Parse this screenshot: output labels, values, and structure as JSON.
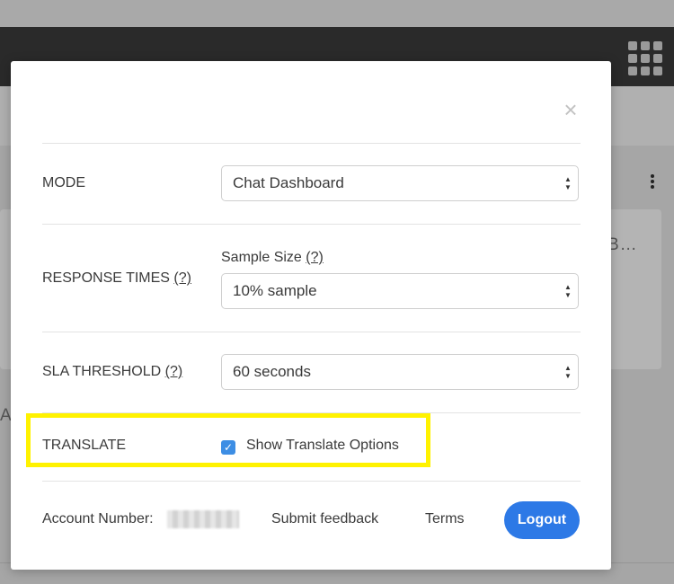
{
  "background": {
    "card_text": "B…",
    "side_letter": "A"
  },
  "modal": {
    "close_icon": "×",
    "mode": {
      "label": "MODE",
      "value": "Chat Dashboard"
    },
    "response_times": {
      "label": "RESPONSE TIMES",
      "help": "(?)",
      "sample_label": "Sample Size",
      "sample_help": "(?)",
      "value": "10% sample"
    },
    "sla": {
      "label": "SLA THRESHOLD",
      "help": "(?)",
      "value": "60 seconds"
    },
    "translate": {
      "label": "TRANSLATE",
      "checkbox_label": "Show Translate Options",
      "checked": true
    },
    "footer": {
      "account_label": "Account Number:",
      "submit_feedback": "Submit feedback",
      "terms": "Terms",
      "logout": "Logout"
    }
  },
  "colors": {
    "accent": "#2d79e6",
    "highlight": "#fff200",
    "checkbox": "#3d8ee4"
  }
}
